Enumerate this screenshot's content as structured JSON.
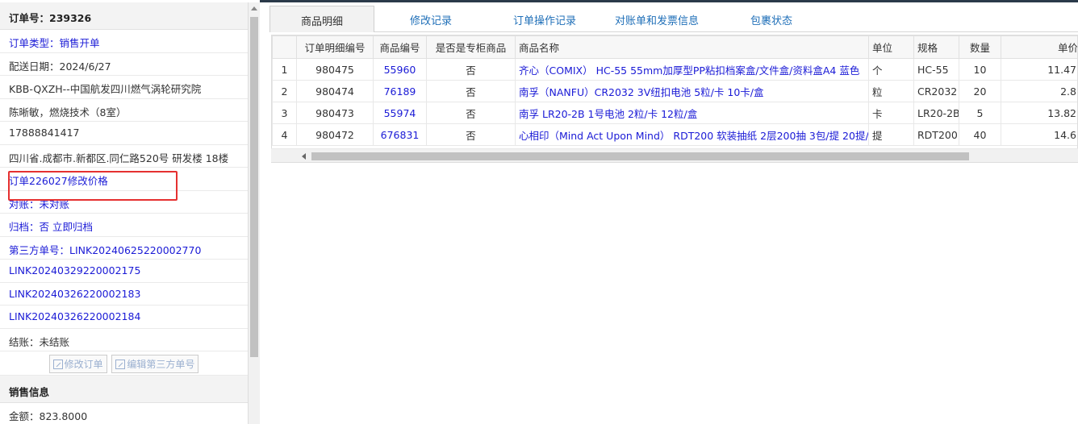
{
  "order": {
    "title": "订单号：239326",
    "type_label": "订单类型：",
    "type_value": "销售开单",
    "delivery_date": "配送日期：2024/6/27",
    "customer": "KBB-QXZH--中国航发四川燃气涡轮研究院",
    "contact": "陈晰敏，燃烧技术（8室）",
    "phone": "17888841417",
    "address": "四川省.成都市.新都区.同仁路520号 研发楼 18楼",
    "price_change": "订单226027修改价格",
    "reconcile_label": "对账：",
    "reconcile_value": "未对账",
    "archive_label": "归档：",
    "archive_value": "否 立即归档",
    "third_party_label": "第三方单号：",
    "third_party_1": "LINK20240625220002770",
    "third_party_2": "LINK20240329220002175",
    "third_party_3": "LINK20240326220002183",
    "third_party_4": "LINK20240326220002184",
    "settlement": "结账：未结账",
    "edit_order_button": "修改订单",
    "edit_third_party_button": "编辑第三方单号"
  },
  "sales": {
    "title": "销售信息",
    "amount": "金额：823.8000"
  },
  "tabs": [
    "商品明细",
    "修改记录",
    "订单操作记录",
    "对账单和发票信息",
    "包裹状态"
  ],
  "table": {
    "headers": [
      "",
      "订单明细编号",
      "商品编号",
      "是否是专柜商品",
      "商品名称",
      "单位",
      "规格",
      "数量",
      "单价"
    ],
    "rows": [
      [
        "1",
        "980475",
        "55960",
        "否",
        "齐心（COMIX） HC-55 55mm加厚型PP粘扣档案盒/文件盒/资料盒A4 蓝色",
        "个",
        "HC-55",
        "10",
        "11.47"
      ],
      [
        "2",
        "980474",
        "76189",
        "否",
        "南孚（NANFU）CR2032 3V纽扣电池 5粒/卡 10卡/盒",
        "粒",
        "CR2032",
        "20",
        "2.8"
      ],
      [
        "3",
        "980473",
        "55974",
        "否",
        "南孚 LR20-2B 1号电池 2粒/卡 12粒/盒",
        "卡",
        "LR20-2B",
        "5",
        "13.82"
      ],
      [
        "4",
        "980472",
        "676831",
        "否",
        "心相印（Mind Act Upon Mind） RDT200 软装抽纸 2层200抽 3包/提 20提/箱",
        "提",
        "RDT200",
        "40",
        "14.6"
      ]
    ]
  },
  "colors": {
    "link": "#1a1ad6",
    "highlight": "#e53030",
    "tab_text": "#1f6fb8"
  }
}
